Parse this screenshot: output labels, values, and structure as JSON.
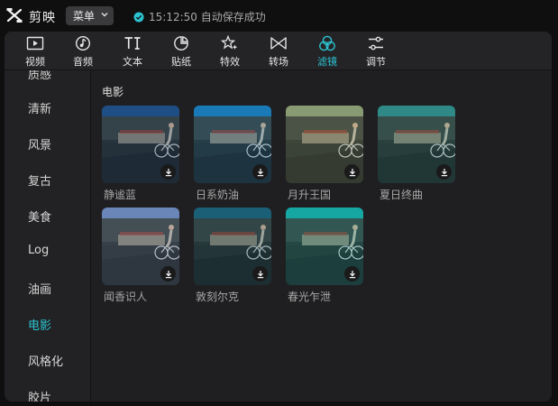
{
  "app": {
    "name": "剪映",
    "menu_label": "菜单",
    "save_status": "15:12:50 自动保存成功"
  },
  "toolbar": [
    {
      "label": "视频",
      "icon": "video-icon"
    },
    {
      "label": "音频",
      "icon": "audio-icon"
    },
    {
      "label": "文本",
      "icon": "text-icon"
    },
    {
      "label": "贴纸",
      "icon": "sticker-icon"
    },
    {
      "label": "特效",
      "icon": "effects-icon"
    },
    {
      "label": "转场",
      "icon": "transition-icon"
    },
    {
      "label": "滤镜",
      "icon": "filter-icon",
      "active": true
    },
    {
      "label": "调节",
      "icon": "adjust-icon"
    }
  ],
  "sidebar": [
    {
      "label": "质感"
    },
    {
      "label": "清新"
    },
    {
      "label": "风景"
    },
    {
      "label": "复古"
    },
    {
      "label": "美食"
    },
    {
      "label": "Log"
    },
    {
      "label": "油画"
    },
    {
      "label": "电影",
      "active": true
    },
    {
      "label": "风格化"
    },
    {
      "label": "胶片"
    }
  ],
  "section": {
    "title": "电影"
  },
  "filters": [
    {
      "label": "静谧蓝",
      "tint": "#1f4f86"
    },
    {
      "label": "日系奶油",
      "tint": "#1a7ab8"
    },
    {
      "label": "月升王国",
      "tint": "#8a9c73"
    },
    {
      "label": "夏日终曲",
      "tint": "#2f8a87"
    },
    {
      "label": "闻香识人",
      "tint": "#6b86b8"
    },
    {
      "label": "敦刻尔克",
      "tint": "#1c5f78"
    },
    {
      "label": "春光乍泄",
      "tint": "#17a7a3"
    }
  ],
  "colors": {
    "accent": "#2cc3d1"
  }
}
